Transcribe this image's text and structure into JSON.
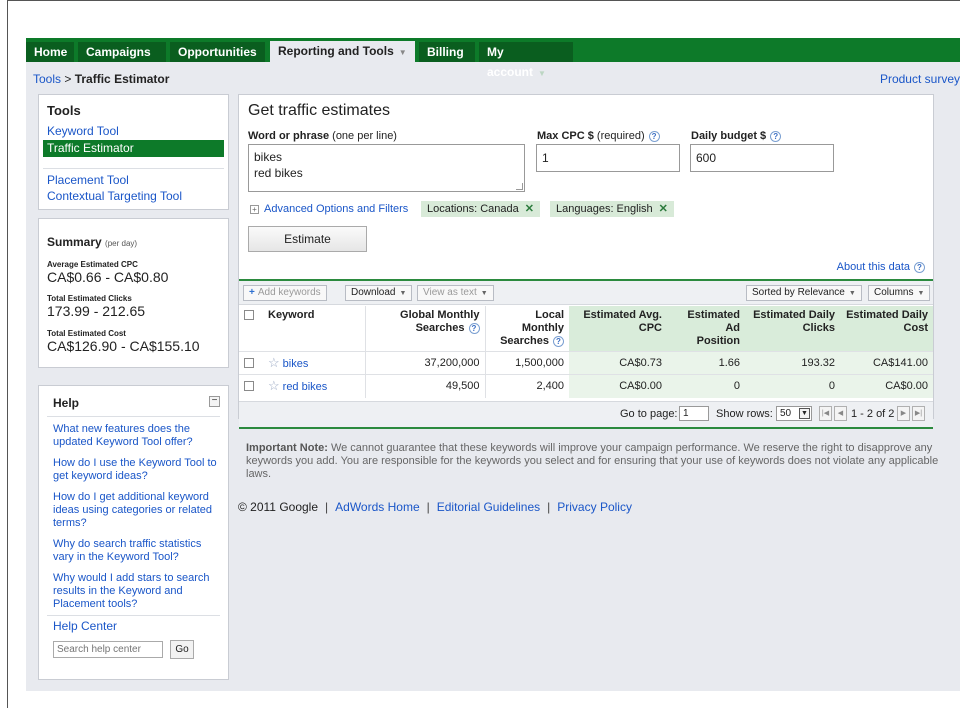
{
  "nav": {
    "tabs": [
      {
        "label": "Home"
      },
      {
        "label": "Campaigns"
      },
      {
        "label": "Opportunities"
      },
      {
        "label": "Reporting and Tools"
      },
      {
        "label": "Billing"
      },
      {
        "label": "My account"
      }
    ]
  },
  "breadcrumb": {
    "parent": "Tools",
    "separator": ">",
    "current": "Traffic Estimator"
  },
  "product_survey": "Product survey",
  "tools": {
    "title": "Tools",
    "items": [
      "Keyword Tool",
      "Traffic Estimator",
      "Placement Tool",
      "Contextual Targeting Tool"
    ]
  },
  "summary": {
    "title": "Summary",
    "subtitle": "(per day)",
    "cpc_label": "Average Estimated CPC",
    "cpc_value": "CA$0.66 - CA$0.80",
    "clicks_label": "Total Estimated Clicks",
    "clicks_value": "173.99 - 212.65",
    "cost_label": "Total Estimated Cost",
    "cost_value": "CA$126.90 - CA$155.10"
  },
  "help": {
    "title": "Help",
    "questions": [
      "What new features does the updated Keyword Tool offer?",
      "How do I use the Keyword Tool to get keyword ideas?",
      "How do I get additional keyword ideas using categories or related terms?",
      "Why do search traffic statistics vary in the Keyword Tool?",
      "Why would I add stars to search results in the Keyword and Placement tools?"
    ],
    "help_center": "Help Center",
    "search_placeholder": "Search help center",
    "go_label": "Go"
  },
  "estimator": {
    "title": "Get traffic estimates",
    "word_label": "Word or phrase",
    "word_hint": "(one per line)",
    "words": [
      "bikes",
      "red bikes"
    ],
    "max_cpc_label": "Max CPC $",
    "max_cpc_hint": "(required)",
    "max_cpc_value": "1",
    "budget_label": "Daily budget $",
    "budget_value": "600",
    "advanced_label": "Advanced Options and Filters",
    "location_chip": "Locations: Canada",
    "language_chip": "Languages: English",
    "estimate_label": "Estimate",
    "about_label": "About this data"
  },
  "toolbar": {
    "add_keywords": "Add keywords",
    "download": "Download",
    "view_as_text": "View as text",
    "sorted_by": "Sorted by Relevance",
    "columns": "Columns"
  },
  "table": {
    "headers": {
      "keyword": "Keyword",
      "global_1": "Global Monthly",
      "global_2": "Searches",
      "local_1": "Local Monthly",
      "local_2": "Searches",
      "cpc_1": "Estimated Avg.",
      "cpc_2": "CPC",
      "pos_1": "Estimated Ad",
      "pos_2": "Position",
      "clicks_1": "Estimated Daily",
      "clicks_2": "Clicks",
      "cost_1": "Estimated Daily",
      "cost_2": "Cost"
    },
    "rows": [
      {
        "keyword": "bikes",
        "global": "37,200,000",
        "local": "1,500,000",
        "cpc": "CA$0.73",
        "position": "1.66",
        "clicks": "193.32",
        "cost": "CA$141.00"
      },
      {
        "keyword": "red bikes",
        "global": "49,500",
        "local": "2,400",
        "cpc": "CA$0.00",
        "position": "0",
        "clicks": "0",
        "cost": "CA$0.00"
      }
    ]
  },
  "pager": {
    "go_to_page": "Go to page:",
    "page_value": "1",
    "show_rows": "Show rows:",
    "rows_value": "50",
    "range": "1 - 2 of 2"
  },
  "note": {
    "label": "Important Note:",
    "text": "We cannot guarantee that these keywords will improve your campaign performance. We reserve the right to disapprove any keywords you add. You are responsible for the keywords you select and for ensuring that your use of keywords does not violate any applicable laws."
  },
  "footer": {
    "copyright": "© 2011 Google",
    "links": [
      "AdWords Home",
      "Editorial Guidelines",
      "Privacy Policy"
    ]
  },
  "colors": {
    "brand_green": "#0d7a29",
    "link_blue": "#1a56c8",
    "panel_bg": "#e8eaef"
  }
}
